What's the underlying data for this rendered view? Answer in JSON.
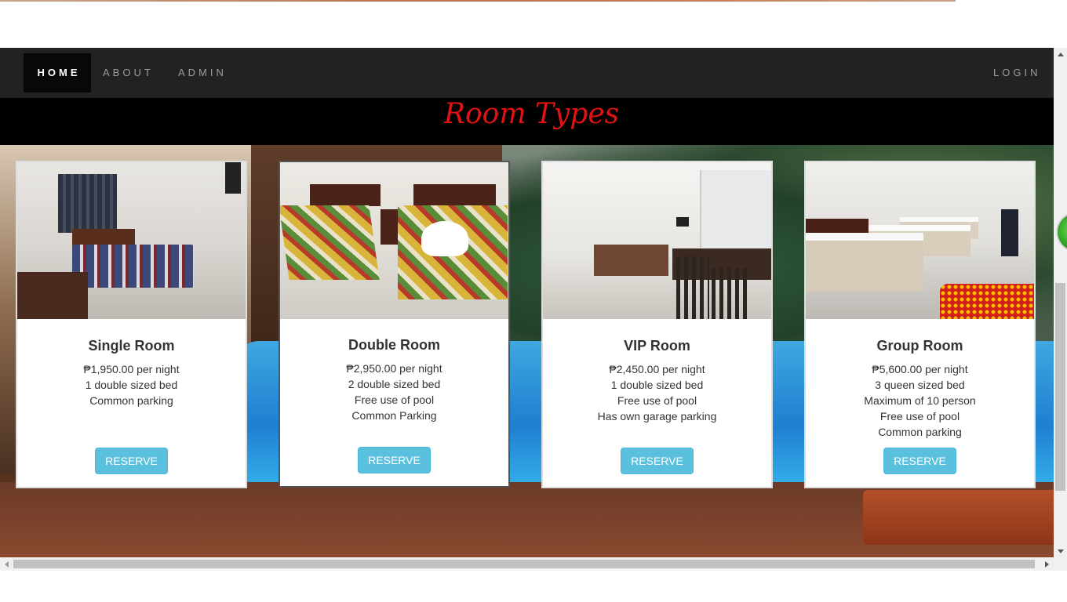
{
  "nav": {
    "home": "HOME",
    "about": "ABOUT",
    "admin": "ADMIN",
    "login": "LOGIN"
  },
  "page_title": "Room Types",
  "rooms": [
    {
      "name": "Single Room",
      "details": [
        "₱1,950.00 per night",
        "1 double sized bed",
        "Common parking"
      ],
      "button": "RESERVE"
    },
    {
      "name": "Double Room",
      "details": [
        "₱2,950.00 per night",
        "2 double sized bed",
        "Free use of pool",
        "Common Parking"
      ],
      "button": "RESERVE"
    },
    {
      "name": "VIP Room",
      "details": [
        "₱2,450.00 per night",
        "1 double sized bed",
        "Free use of pool",
        "Has own garage parking"
      ],
      "button": "RESERVE"
    },
    {
      "name": "Group Room",
      "details": [
        "₱5,600.00 per night",
        "3 queen sized bed",
        "Maximum of 10 person",
        "Free use of pool",
        "Common parking"
      ],
      "button": "RESERVE"
    }
  ],
  "colors": {
    "navbar": "#222222",
    "title": "#e31212",
    "button": "#5bc0de"
  }
}
